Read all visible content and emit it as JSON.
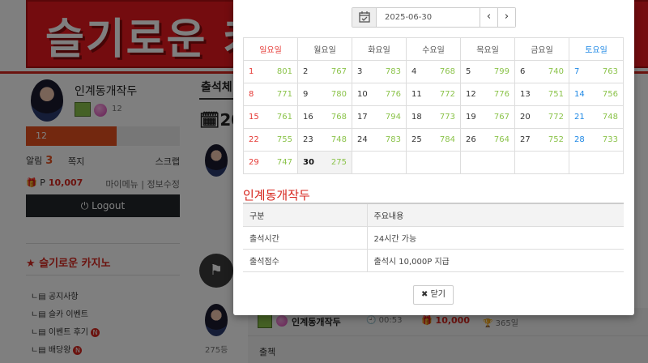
{
  "background": {
    "banner_text": "슬기로운 카",
    "user": {
      "name": "인계동개작두",
      "level": "12",
      "xp_percent": 59,
      "xp_label": "12"
    },
    "alarm_label": "알림",
    "alarm_count": "3",
    "memo_label": "쪽지",
    "scrap_label": "스크랩",
    "point_label": "P",
    "point_value": "10,007",
    "my_menu": "마이메뉴",
    "info_edit": "정보수정",
    "separator": "|",
    "logout_label": "Logout",
    "casino_title": "슬기로운 카지노",
    "menu": [
      "공지사항",
      "슬카 이벤트",
      "이벤트 후기",
      "배당왕"
    ],
    "new_badge": "N",
    "page_title": "출석체",
    "calendar_title": "20",
    "count_label": "275등",
    "list_row": {
      "name": "인계동개작두",
      "time": "00:53",
      "points": "10,000",
      "rank": "365일",
      "memo": "출첵"
    },
    "colors": {
      "brand_red": "#d7261e",
      "xp_orange": "#e7511f",
      "point_green": "#8bc34a"
    }
  },
  "modal": {
    "date_value": "2025-06-30",
    "prev_icon": "‹",
    "next_icon": "›",
    "weekdays": [
      "일요일",
      "월요일",
      "화요일",
      "수요일",
      "목요일",
      "금요일",
      "토요일"
    ],
    "weeks": [
      [
        {
          "day": "1",
          "points": "801"
        },
        {
          "day": "2",
          "points": "767"
        },
        {
          "day": "3",
          "points": "783"
        },
        {
          "day": "4",
          "points": "768"
        },
        {
          "day": "5",
          "points": "799"
        },
        {
          "day": "6",
          "points": "740"
        },
        {
          "day": "7",
          "points": "763"
        }
      ],
      [
        {
          "day": "8",
          "points": "771"
        },
        {
          "day": "9",
          "points": "780"
        },
        {
          "day": "10",
          "points": "776"
        },
        {
          "day": "11",
          "points": "772"
        },
        {
          "day": "12",
          "points": "776"
        },
        {
          "day": "13",
          "points": "751"
        },
        {
          "day": "14",
          "points": "756"
        }
      ],
      [
        {
          "day": "15",
          "points": "761"
        },
        {
          "day": "16",
          "points": "768"
        },
        {
          "day": "17",
          "points": "794"
        },
        {
          "day": "18",
          "points": "773"
        },
        {
          "day": "19",
          "points": "767"
        },
        {
          "day": "20",
          "points": "772"
        },
        {
          "day": "21",
          "points": "748"
        }
      ],
      [
        {
          "day": "22",
          "points": "755"
        },
        {
          "day": "23",
          "points": "748"
        },
        {
          "day": "24",
          "points": "783"
        },
        {
          "day": "25",
          "points": "784"
        },
        {
          "day": "26",
          "points": "764"
        },
        {
          "day": "27",
          "points": "752"
        },
        {
          "day": "28",
          "points": "733"
        }
      ],
      [
        {
          "day": "29",
          "points": "747"
        },
        {
          "day": "30",
          "points": "275",
          "today": true
        },
        null,
        null,
        null,
        null,
        null
      ]
    ],
    "user_name": "인계동개작두",
    "info_table": {
      "headers": [
        "구분",
        "주요내용"
      ],
      "rows": [
        [
          "출석시간",
          "24시간 가능"
        ],
        [
          "출석점수",
          "출석시 10,000P 지급"
        ]
      ]
    },
    "close_label": "닫기",
    "close_icon": "✖"
  }
}
